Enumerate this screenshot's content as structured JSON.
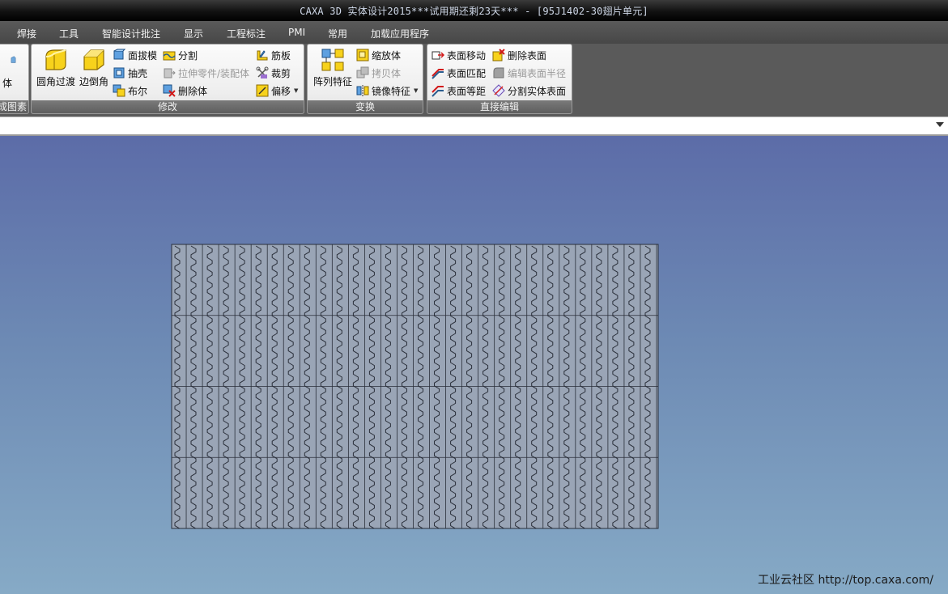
{
  "window": {
    "title": "CAXA 3D 实体设计2015***试用期还剩23天*** - [95J1402-30翅片单元]"
  },
  "menu": [
    "焊接",
    "工具",
    "智能设计批注",
    "显示",
    "工程标注",
    "PMI",
    "常用",
    "加载应用程序"
  ],
  "ribbon": {
    "panels": {
      "partial": {
        "button": "体",
        "label": "成图素"
      },
      "modify": {
        "label": "修改",
        "big": [
          "圆角过渡",
          "边倒角"
        ],
        "col1": [
          "面拔模",
          "抽壳",
          "布尔"
        ],
        "col2": [
          "分割",
          "拉伸零件/装配体",
          "删除体"
        ],
        "col3": [
          "筋板",
          "裁剪",
          "偏移"
        ]
      },
      "transform": {
        "label": "变换",
        "big": "阵列特征",
        "items": [
          "缩放体",
          "拷贝体",
          "镜像特征"
        ]
      },
      "direct_edit": {
        "label": "直接编辑",
        "col1": [
          "表面移动",
          "表面匹配",
          "表面等距"
        ],
        "col2": [
          "删除表面",
          "编辑表面半径",
          "分割实体表面"
        ]
      }
    },
    "disabled_items": [
      "拉伸零件/装配体",
      "拷贝体",
      "编辑表面半径"
    ]
  },
  "viewport": {
    "background_top": "#5c6ca8",
    "background_bottom": "#86aac6",
    "model": {
      "fill": "#9aa5b6",
      "edge": "#2a2f3a",
      "columns": 30,
      "rows": 4
    },
    "watermark": "工业云社区 http://top.caxa.com/"
  },
  "icons": {
    "fillet": "fillet-icon",
    "chamfer": "chamfer-icon",
    "pattern": "array-pattern-icon"
  }
}
